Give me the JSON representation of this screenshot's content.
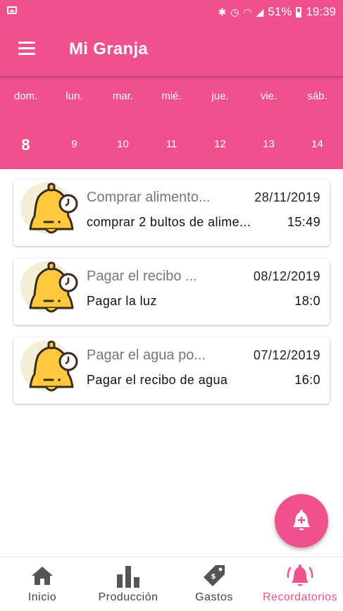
{
  "status_bar": {
    "battery": "51%",
    "time": "19:39"
  },
  "app_bar": {
    "title": "Mi Granja",
    "menu_icon": "hamburger-menu-icon"
  },
  "calendar": {
    "days": [
      {
        "name": "dom.",
        "number": "8",
        "selected": true
      },
      {
        "name": "lun.",
        "number": "9",
        "selected": false
      },
      {
        "name": "mar.",
        "number": "10",
        "selected": false
      },
      {
        "name": "mié.",
        "number": "11",
        "selected": false
      },
      {
        "name": "jue.",
        "number": "12",
        "selected": false
      },
      {
        "name": "vie.",
        "number": "13",
        "selected": false
      },
      {
        "name": "sáb.",
        "number": "14",
        "selected": false
      }
    ]
  },
  "reminders": [
    {
      "title": "Comprar alimento...",
      "date": "28/11/2019",
      "description": "comprar 2 bultos de alime...",
      "time": "15:49",
      "icon": "bell-clock-icon"
    },
    {
      "title": "Pagar el recibo ...",
      "date": "08/12/2019",
      "description": "Pagar la luz",
      "time": "18:0",
      "icon": "bell-clock-icon"
    },
    {
      "title": "Pagar el agua po...",
      "date": "07/12/2019",
      "description": "Pagar el recibo de agua",
      "time": "16:0",
      "icon": "bell-clock-icon"
    }
  ],
  "fab": {
    "icon": "add-alarm-icon"
  },
  "bottom_nav": {
    "items": [
      {
        "label": "Inicio",
        "icon": "home-icon",
        "active": false
      },
      {
        "label": "Producción",
        "icon": "bar-chart-icon",
        "active": false
      },
      {
        "label": "Gastos",
        "icon": "price-tag-icon",
        "active": false
      },
      {
        "label": "Recordatorios",
        "icon": "bell-alert-icon",
        "active": true
      }
    ]
  },
  "colors": {
    "primary": "#f0508c",
    "inactive": "#555555",
    "bell": "#ffc83d"
  }
}
